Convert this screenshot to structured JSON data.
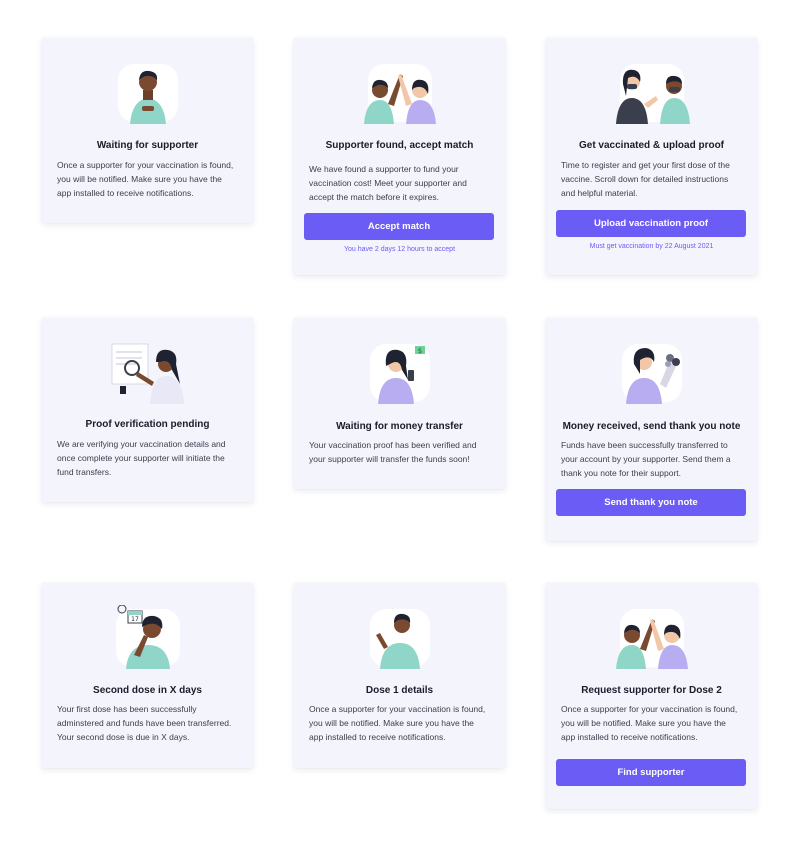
{
  "colors": {
    "accent": "#6a5cf5",
    "card_bg": "#f4f4fc",
    "teal": "#8fd6c8",
    "lavender": "#b7adf0"
  },
  "cards": [
    {
      "title": "Waiting for supporter",
      "lines": [
        "Once a supporter for your vaccination is found,",
        "you will be notified. Make sure you have the",
        "app installed to receive notifications."
      ],
      "illustration": "person-waiting"
    },
    {
      "title": "Supporter found, accept match",
      "lines": [
        "We have found a supporter to fund your",
        "vaccination cost! Meet your supporter and",
        "accept the match before it expires."
      ],
      "button": "Accept match",
      "note": "You have 2 days 12 hours to accept",
      "illustration": "high-five"
    },
    {
      "title": "Get vaccinated & upload proof",
      "lines": [
        "Time to register and get your first dose of the",
        "vaccine. Scroll down for detailed instructions",
        "and helpful material."
      ],
      "button": "Upload vaccination proof",
      "note": "Must get vaccination by 22 August 2021",
      "illustration": "nurse-vaccinating"
    },
    {
      "title": "Proof verification pending",
      "lines": [
        "We are verifying your vaccination details and",
        "once complete your supporter will initiate the",
        "fund transfers."
      ],
      "illustration": "person-inspecting"
    },
    {
      "title": "Waiting for money transfer",
      "lines": [
        "Your vaccination proof has been verified and",
        "your supporter will transfer the funds soon!"
      ],
      "illustration": "person-phone-money"
    },
    {
      "title": "Money received, send thank you note",
      "lines": [
        "Funds have been successfully transferred to",
        "your account by your supporter. Send them a",
        "thank you note for their support."
      ],
      "button": "Send thank you note",
      "illustration": "person-flowers"
    },
    {
      "title": "Second dose in X days",
      "lines": [
        "Your first dose has been successfully",
        "adminstered and funds have been transferred.",
        "Your second dose is due in X days."
      ],
      "illustration": "person-calendar",
      "calendar_number": "17"
    },
    {
      "title": "Dose 1 details",
      "lines": [
        "Once a supporter for your vaccination is found,",
        "you will be notified. Make sure you have the",
        "app installed to receive notifications."
      ],
      "illustration": "person-waving"
    },
    {
      "title": "Request supporter for Dose 2",
      "lines": [
        "Once a supporter for your vaccination is found,",
        "you will be notified. Make sure you have the",
        "app installed to receive notifications."
      ],
      "button": "Find supporter",
      "illustration": "high-five"
    }
  ]
}
